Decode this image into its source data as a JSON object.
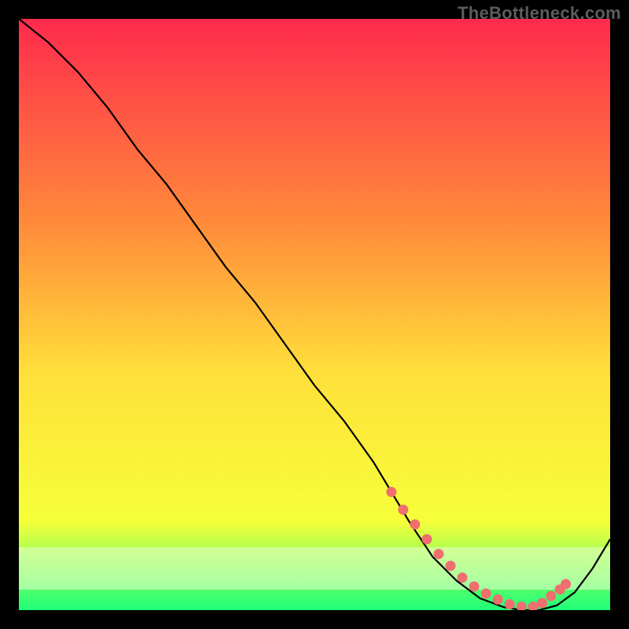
{
  "watermark": "TheBottleneck.com",
  "chart_data": {
    "type": "line",
    "title": "",
    "xlabel": "",
    "ylabel": "",
    "xlim": [
      0,
      100
    ],
    "ylim": [
      0,
      100
    ],
    "grid": false,
    "background_gradient": {
      "top": "#ff2a4d",
      "mid1": "#ff8c3a",
      "mid2": "#ffe03a",
      "mid3": "#f6ff3a",
      "bottom": "#1eff7a"
    },
    "series": [
      {
        "name": "bottleneck-curve",
        "color": "#000000",
        "x": [
          0,
          5,
          10,
          15,
          20,
          25,
          30,
          35,
          40,
          45,
          50,
          55,
          60,
          63,
          66,
          70,
          74,
          78,
          82,
          85,
          88,
          91,
          94,
          97,
          100
        ],
        "y": [
          100,
          96,
          91,
          85,
          78,
          72,
          65,
          58,
          52,
          45,
          38,
          32,
          25,
          20,
          15,
          9,
          5,
          2,
          0.5,
          0,
          0,
          0.8,
          3,
          7,
          12
        ]
      }
    ],
    "marker_cluster": {
      "name": "sweet-spot-markers",
      "color": "#ef6e6e",
      "x": [
        63,
        65,
        67,
        69,
        71,
        73,
        75,
        77,
        79,
        81,
        83,
        85,
        87,
        88.5,
        90,
        91.5,
        92.5
      ],
      "y": [
        20,
        17,
        14.5,
        12,
        9.5,
        7.5,
        5.5,
        4,
        2.8,
        1.8,
        1,
        0.6,
        0.6,
        1.2,
        2.4,
        3.5,
        4.4
      ]
    }
  }
}
